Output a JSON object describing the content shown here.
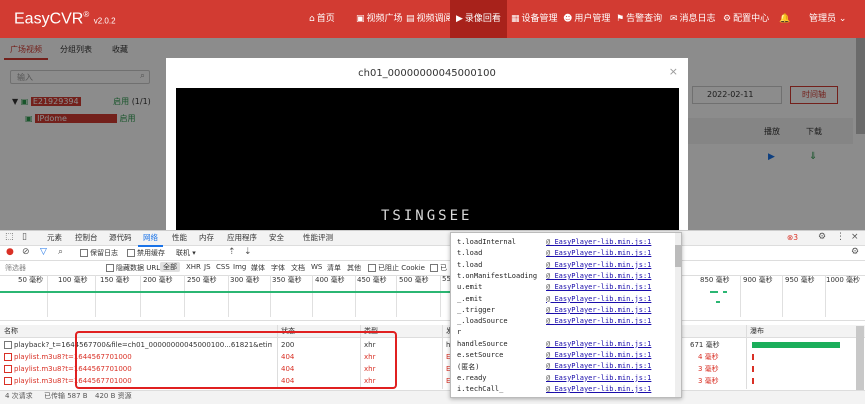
{
  "app": {
    "logo": "EasyCVR",
    "logo_reg": "®",
    "version": "v2.0.2",
    "nav": [
      {
        "icon": "home-icon",
        "glyph": "⌂",
        "label": "首页"
      },
      {
        "icon": "video-square-icon",
        "glyph": "▣",
        "label": "视频广场"
      },
      {
        "icon": "video-call-icon",
        "glyph": "▤",
        "label": "视频调阅"
      },
      {
        "icon": "playback-icon",
        "glyph": "▶",
        "label": "录像回看"
      },
      {
        "icon": "device-icon",
        "glyph": "▦",
        "label": "设备管理"
      },
      {
        "icon": "user-icon",
        "glyph": "☻",
        "label": "用户管理"
      },
      {
        "icon": "alarm-icon",
        "glyph": "⚑",
        "label": "告警查询"
      },
      {
        "icon": "message-icon",
        "glyph": "✉",
        "label": "消息日志"
      },
      {
        "icon": "config-icon",
        "glyph": "⚙",
        "label": "配置中心"
      }
    ],
    "bell_glyph": "🔔",
    "user": "管理员",
    "user_caret": "⌄"
  },
  "left_panel": {
    "tabs": [
      "广场视频",
      "分组列表",
      "收藏"
    ],
    "search_placeholder": "输入",
    "search_glyph": "⌕",
    "tree": [
      {
        "arrow": "▼",
        "icon": "▣",
        "name": "E21929394",
        "status": "启用",
        "count": "(1/1)"
      },
      {
        "arrow": "",
        "icon": "▣",
        "name": "IPdome",
        "status": "启用",
        "count": ""
      }
    ]
  },
  "right_bg": {
    "date": "2022-02-11",
    "timeline_button": "时间轴",
    "col_play": "播放",
    "col_download": "下载",
    "play_glyph": "▶",
    "download_glyph": "⇓"
  },
  "modal": {
    "title": "ch01_00000000045000100",
    "close_glyph": "×",
    "video_watermark": "TSINGSEE"
  },
  "devtools": {
    "tabs": [
      "元素",
      "控制台",
      "源代码",
      "网络",
      "性能",
      "内存",
      "应用程序",
      "安全",
      "性能评测"
    ],
    "active_tab": "网络",
    "error_count": "3",
    "toolbar": {
      "preserve_log": "保留日志",
      "disable_cache": "禁用缓存",
      "throttle": "联机"
    },
    "filter_label": "筛选器",
    "hide_data_urls": "隐藏数据 URL",
    "types": [
      "全部",
      "XHR",
      "JS",
      "CSS",
      "Img",
      "媒体",
      "字体",
      "文档",
      "WS",
      "清单",
      "其他"
    ],
    "blocked_cookies": "已阻止 Cookie",
    "blocked_req": "已",
    "timeline_ticks": [
      "50 毫秒",
      "100 毫秒",
      "150 毫秒",
      "200 毫秒",
      "250 毫秒",
      "300 毫秒",
      "350 毫秒",
      "400 毫秒",
      "450 毫秒",
      "500 毫秒",
      "55",
      "850 毫秒",
      "900 毫秒",
      "950 毫秒",
      "1000 毫秒"
    ],
    "columns": {
      "name": "名称",
      "status": "状态",
      "type": "类型",
      "initiator": "发",
      "waterfall": "瀑布"
    },
    "requests": [
      {
        "name": "playback?_t=1644567700&file=ch01_00000000045000100...61821&etime=202202...",
        "status": "200",
        "type": "xhr",
        "initiator": "h",
        "time": "671 毫秒",
        "error": false
      },
      {
        "name": "playlist.m3u8?t=1644567701000",
        "status": "404",
        "type": "xhr",
        "initiator": "E",
        "time": "4 毫秒",
        "error": true
      },
      {
        "name": "playlist.m3u8?t=1644567701000",
        "status": "404",
        "type": "xhr",
        "initiator": "E",
        "time": "3 毫秒",
        "error": true
      },
      {
        "name": "playlist.m3u8?t=1644567701000",
        "status": "404",
        "type": "xhr",
        "initiator": "E",
        "time": "3 毫秒",
        "error": true
      }
    ],
    "status_bar": {
      "requests": "4 次请求",
      "transferred": "已传输 587 B",
      "resources": "420 B 资源"
    },
    "call_stack": [
      {
        "fn": "t.loadInternal",
        "loc": "EasyPlayer-lib.min.js:1"
      },
      {
        "fn": "t.load",
        "loc": "EasyPlayer-lib.min.js:1"
      },
      {
        "fn": "t.load",
        "loc": "EasyPlayer-lib.min.js:1"
      },
      {
        "fn": "t.onManifestLoading",
        "loc": "EasyPlayer-lib.min.js:1"
      },
      {
        "fn": "u.emit",
        "loc": "EasyPlayer-lib.min.js:1"
      },
      {
        "fn": "_.emit",
        "loc": "EasyPlayer-lib.min.js:1"
      },
      {
        "fn": "_.trigger",
        "loc": "EasyPlayer-lib.min.js:1"
      },
      {
        "fn": "_.loadSource",
        "loc": "EasyPlayer-lib.min.js:1"
      },
      {
        "fn": "r",
        "loc": ""
      },
      {
        "fn": "handleSource",
        "loc": "EasyPlayer-lib.min.js:1"
      },
      {
        "fn": "e.setSource",
        "loc": "EasyPlayer-lib.min.js:1"
      },
      {
        "fn": "(匿名)",
        "loc": "EasyPlayer-lib.min.js:1"
      },
      {
        "fn": "e.ready",
        "loc": "EasyPlayer-lib.min.js:1"
      },
      {
        "fn": "i.techCall_",
        "loc": "EasyPlayer-lib.min.js:1"
      }
    ],
    "at_sign": "@"
  },
  "colors": {
    "brand": "#d23b32",
    "error": "#d93025",
    "link": "#1a0dab",
    "accent": "#1a73e8"
  }
}
